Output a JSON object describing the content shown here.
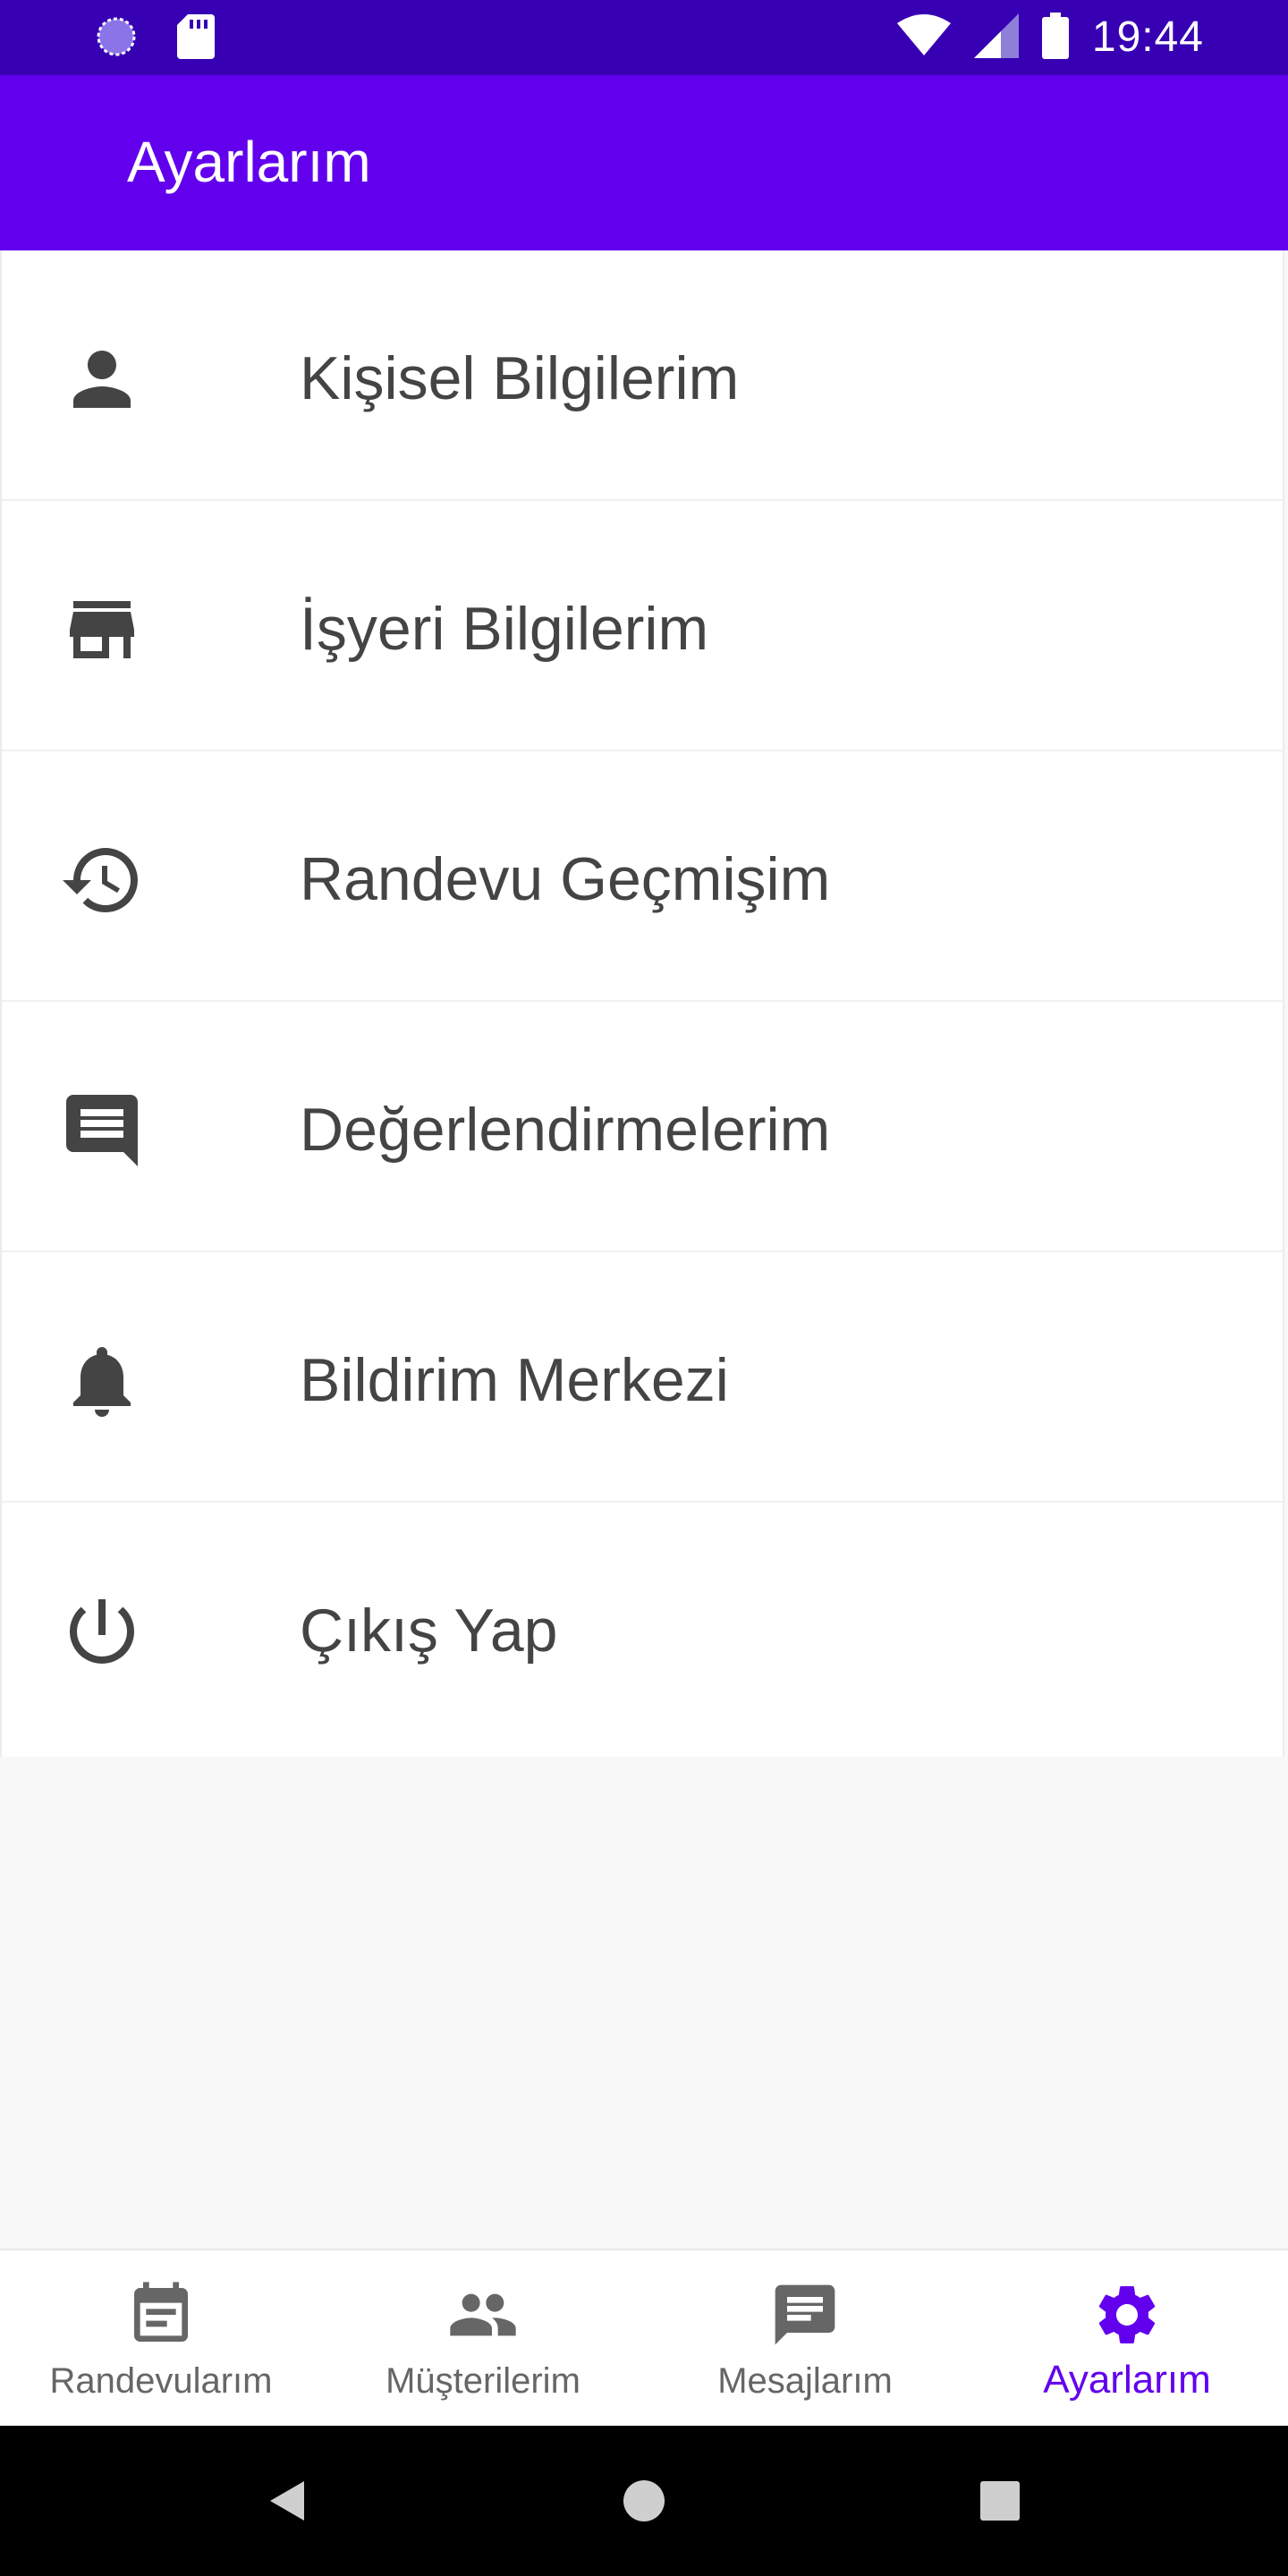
{
  "status_bar": {
    "time": "19:44",
    "icons": [
      "data-saver-icon",
      "sd-card-icon",
      "wifi-icon",
      "signal-icon",
      "battery-icon"
    ]
  },
  "app_bar": {
    "title": "Ayarlarım",
    "color": "#6200ee",
    "status_color": "#3700b3"
  },
  "menu": {
    "items": [
      {
        "label": "Kişisel Bilgilerim",
        "icon": "person-icon"
      },
      {
        "label": "İşyeri Bilgilerim",
        "icon": "store-icon"
      },
      {
        "label": "Randevu Geçmişim",
        "icon": "history-icon"
      },
      {
        "label": "Değerlendirmelerim",
        "icon": "comment-icon"
      },
      {
        "label": "Bildirim Merkezi",
        "icon": "bell-icon"
      },
      {
        "label": "Çıkış Yap",
        "icon": "power-icon"
      }
    ]
  },
  "bottom_nav": {
    "items": [
      {
        "label": "Randevularım",
        "icon": "calendar-icon",
        "active": false
      },
      {
        "label": "Müşterilerim",
        "icon": "people-icon",
        "active": false
      },
      {
        "label": "Mesajlarım",
        "icon": "chat-icon",
        "active": false
      },
      {
        "label": "Ayarlarım",
        "icon": "settings-icon",
        "active": true
      }
    ],
    "active_color": "#6200ee",
    "inactive_color": "#666666"
  },
  "system_nav": {
    "buttons": [
      "back-icon",
      "home-icon",
      "recents-icon"
    ]
  }
}
